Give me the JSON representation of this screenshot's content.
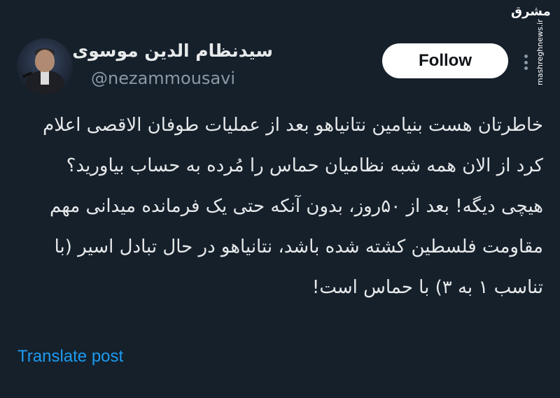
{
  "watermark": {
    "logo_text": "مشرق",
    "url": "mashreghnews.ir"
  },
  "author": {
    "display_name": "سیدنظام الدین موسوی",
    "handle": "@nezammousavi"
  },
  "actions": {
    "follow_label": "Follow",
    "more_icon": "more-dots-icon"
  },
  "tweet": {
    "paragraphs": [
      "خاطرتان هست بنیامین نتانیاهو بعد از عملیات طوفان الاقصی اعلام کرد از الان همه شبه نظامیان حماس را مُرده به حساب بیاورید؟",
      "هیچی دیگه! بعد از ۵۰روز، بدون آنکه حتی یک فرمانده میدانی مهم مقاومت فلسطین کشته شده باشد، نتانیاهو در حال تبادل اسیر (با تناسب ۱ به ۳) با حماس است!"
    ],
    "translate_label": "Translate post"
  },
  "colors": {
    "background": "#15202b",
    "text": "#e7e9ea",
    "secondary_text": "#8b98a5",
    "link": "#1d9bf0",
    "button_bg": "#ffffff"
  }
}
